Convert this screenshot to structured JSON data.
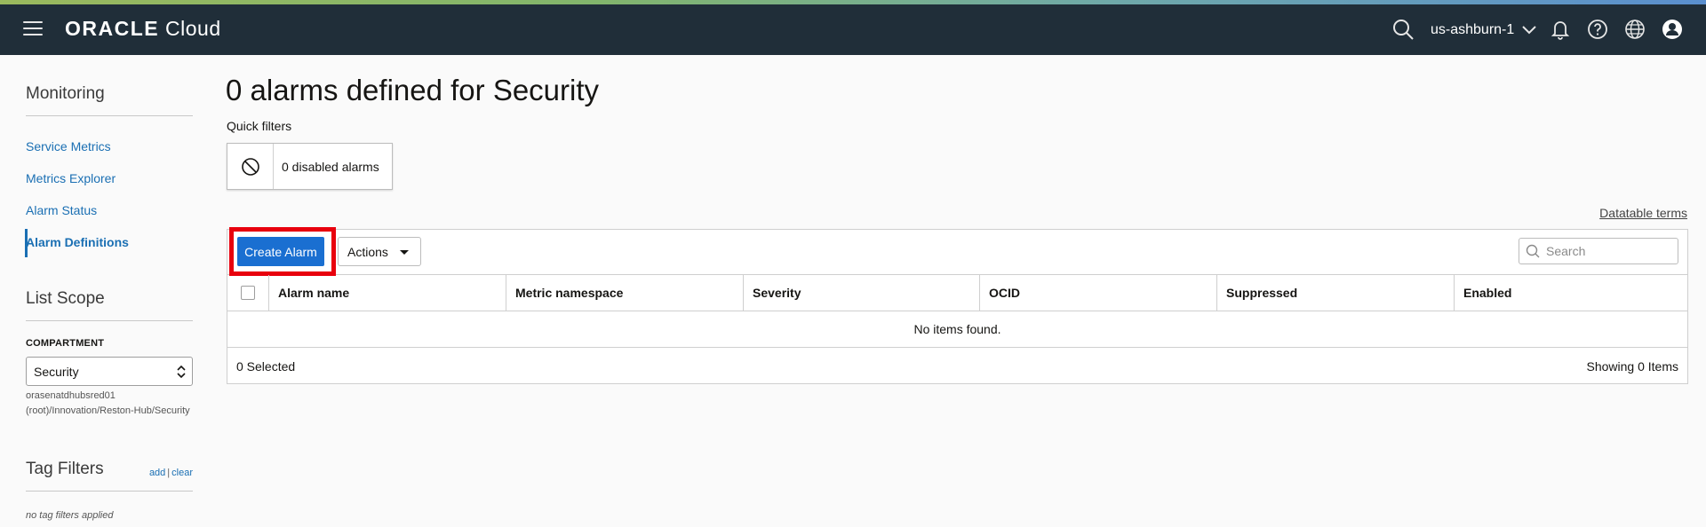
{
  "header": {
    "brand_oracle": "ORACLE",
    "brand_cloud": "Cloud",
    "region": "us-ashburn-1",
    "bar_color": "#202e39"
  },
  "sidebar": {
    "heading": "Monitoring",
    "items": [
      {
        "label": "Service Metrics"
      },
      {
        "label": "Metrics Explorer"
      },
      {
        "label": "Alarm Status"
      },
      {
        "label": "Alarm Definitions",
        "active": true
      }
    ],
    "scope_heading": "List Scope",
    "compartment_label": "COMPARTMENT",
    "compartment_value": "Security",
    "compartment_path": "orasenatdhubsred01 (root)/Innovation/Reston-Hub/Security",
    "tag_filters_heading": "Tag Filters",
    "tag_add": "add",
    "tag_sep": "|",
    "tag_clear": "clear",
    "no_tags": "no tag filters applied"
  },
  "main": {
    "title": "0 alarms defined for Security",
    "quick_filters_label": "Quick filters",
    "quick_filter_disabled": "0 disabled alarms",
    "datatable_terms": "Datatable terms",
    "create_button": "Create Alarm",
    "actions_button": "Actions",
    "search_placeholder": "Search",
    "columns": [
      "Alarm name",
      "Metric namespace",
      "Severity",
      "OCID",
      "Suppressed",
      "Enabled"
    ],
    "empty_message": "No items found.",
    "selected_count": "0 Selected",
    "showing": "Showing 0 Items",
    "accent_color": "#1a6fd1",
    "highlight_color": "#e8000d"
  }
}
